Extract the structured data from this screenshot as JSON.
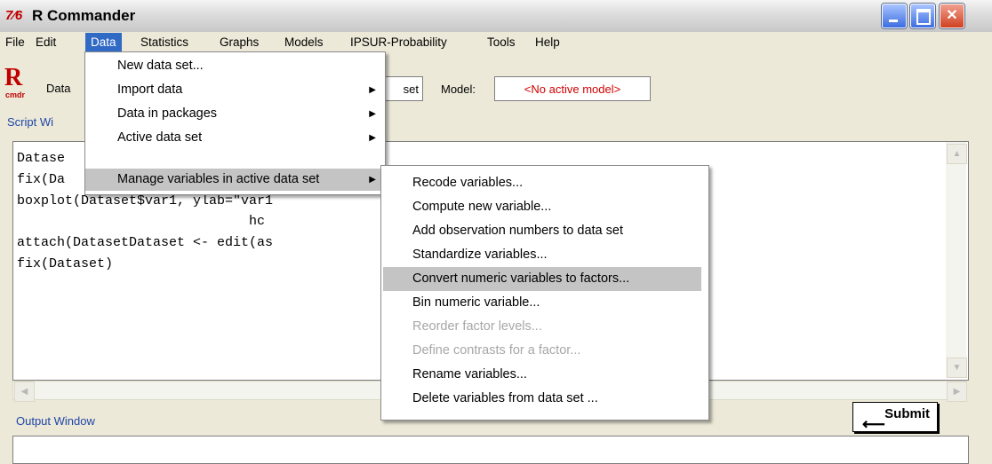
{
  "window": {
    "icon_text": "7⁄6",
    "title": "R Commander"
  },
  "menubar": [
    "File",
    "Edit",
    "Data",
    "Statistics",
    "Graphs",
    "Models",
    "IPSUR-Probability",
    "Tools",
    "Help"
  ],
  "toolbar": {
    "logo_r": "R",
    "logo_sub": "cmdr",
    "data_set_label": "Data",
    "data_set_button_tail": "set",
    "model_label": "Model:",
    "model_value": "<No active model>"
  },
  "script": {
    "label": "Script Wi",
    "lines": [
      "Datase               LL))",
      "fix(Da",
      "boxplot(Dataset$var1, ylab=\"var1                              width=TRUE,",
      "                             hc",
      "attach(DatasetDataset <- edit(as",
      "fix(Dataset)"
    ]
  },
  "output": {
    "label": "Output Window"
  },
  "submit_label": "Submit",
  "data_menu": {
    "items": [
      {
        "label": "New data set...",
        "submenu": false
      },
      {
        "label": "Import data",
        "submenu": true
      },
      {
        "label": "Data in packages",
        "submenu": true
      },
      {
        "label": "Active data set",
        "submenu": true
      },
      {
        "label": "Manage variables in active data set",
        "submenu": true,
        "highlighted": true
      }
    ]
  },
  "submenu": {
    "items": [
      {
        "label": "Recode variables...",
        "enabled": true
      },
      {
        "label": "Compute new variable...",
        "enabled": true
      },
      {
        "label": "Add observation numbers to data set",
        "enabled": true
      },
      {
        "label": "Standardize variables...",
        "enabled": true
      },
      {
        "label": "Convert numeric variables to factors...",
        "enabled": true,
        "highlighted": true
      },
      {
        "label": "Bin numeric variable...",
        "enabled": true
      },
      {
        "label": "Reorder factor levels...",
        "enabled": false
      },
      {
        "label": "Define contrasts for a factor...",
        "enabled": false
      },
      {
        "label": "Rename variables...",
        "enabled": true
      },
      {
        "label": "Delete variables from data set ...",
        "enabled": true
      }
    ]
  }
}
